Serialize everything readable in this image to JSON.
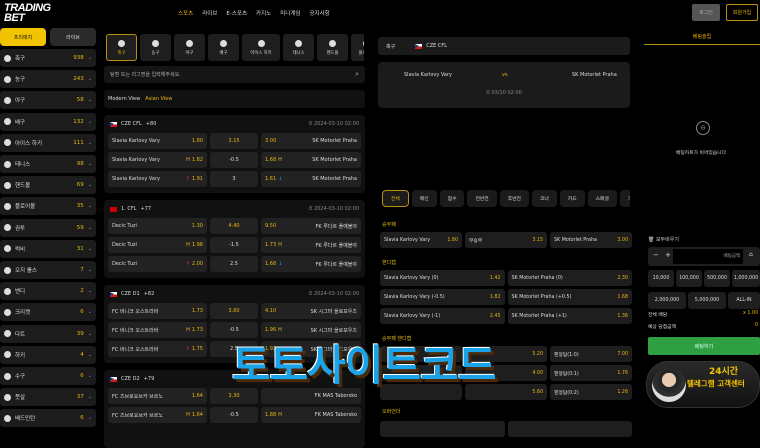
{
  "header": {
    "logo": "TRADING BET",
    "nav": [
      "스포츠",
      "라이브",
      "E-스포츠",
      "카지노",
      "미니게임",
      "공지사항"
    ],
    "login": "로그인",
    "signup": "회원가입"
  },
  "sidebar": {
    "prematch": "프리매치",
    "live": "라이브",
    "items": [
      {
        "label": "축구",
        "count": "938"
      },
      {
        "label": "농구",
        "count": "243"
      },
      {
        "label": "야구",
        "count": "58"
      },
      {
        "label": "배구",
        "count": "132"
      },
      {
        "label": "아이스 하키",
        "count": "111"
      },
      {
        "label": "테니스",
        "count": "98"
      },
      {
        "label": "핸드볼",
        "count": "69"
      },
      {
        "label": "플로어볼",
        "count": "35"
      },
      {
        "label": "권투",
        "count": "59"
      },
      {
        "label": "럭비",
        "count": "31"
      },
      {
        "label": "오지 룰스",
        "count": "7"
      },
      {
        "label": "밴디",
        "count": "2"
      },
      {
        "label": "크리켓",
        "count": "6"
      },
      {
        "label": "다트",
        "count": "39"
      },
      {
        "label": "하키",
        "count": "4"
      },
      {
        "label": "수구",
        "count": "6"
      },
      {
        "label": "풋살",
        "count": "37"
      },
      {
        "label": "배드민턴",
        "count": "6"
      }
    ]
  },
  "sport_tabs": [
    "축구",
    "농구",
    "야구",
    "배구",
    "아이스 하키",
    "테니스",
    "핸드볼",
    "플로어볼"
  ],
  "search": {
    "placeholder": "팀명 또는 리그명을 입력해주세요."
  },
  "views": {
    "modern": "Modern View",
    "asian": "Asian View"
  },
  "leagues": [
    {
      "name": "CZE CFL",
      "more": "+80",
      "time": "2024-03-10 02:00",
      "flag": "cz",
      "rows": [
        [
          "Slavia Karlovy Vary",
          "",
          "1.80",
          "3.15",
          "3.00",
          "",
          "SK Motorlet Praha"
        ],
        [
          "Slavia Karlovy Vary",
          "H",
          "1.82",
          "-0.5",
          "1.68",
          "H",
          "SK Motorlet Praha"
        ],
        [
          "Slavia Karlovy Vary",
          "↑",
          "1.91",
          "3",
          "1.61",
          "↓",
          "SK Motorlet Praha"
        ]
      ]
    },
    {
      "name": "1. CFL",
      "more": "+77",
      "time": "2024-03-10 02:00",
      "flag": "me",
      "rows": [
        [
          "Decic Tuzi",
          "",
          "1.30",
          "4.40",
          "9.50",
          "",
          "FK 루다르 플예블야"
        ],
        [
          "Decic Tuzi",
          "H",
          "1.98",
          "-1.5",
          "1.73",
          "H",
          "FK 루다르 플예블야"
        ],
        [
          "Decic Tuzi",
          "↑",
          "2.00",
          "2.5",
          "1.68",
          "↓",
          "FK 루다르 플예블야"
        ]
      ]
    },
    {
      "name": "CZE D1",
      "more": "+82",
      "time": "2024-03-10 02:00",
      "flag": "cz",
      "rows": [
        [
          "FC 바니크 오스트라바",
          "",
          "1.73",
          "3.60",
          "4.10",
          "",
          "SK 시그마 올로모우츠"
        ],
        [
          "FC 바니크 오스트라바",
          "H",
          "1.73",
          "-0.5",
          "1.96",
          "H",
          "SK 시그마 올로모우츠"
        ],
        [
          "FC 바니크 오스트라바",
          "↑",
          "1.75",
          "2.5",
          "1.92",
          "↓",
          "SK 시그마 올로모우츠"
        ]
      ]
    },
    {
      "name": "CZE D2",
      "more": "+79",
      "time": "",
      "flag": "cz",
      "rows": [
        [
          "FC 즈브로요브카 브르노",
          "",
          "1.64",
          "3.30",
          "",
          "",
          "FK MAS Taborsko"
        ],
        [
          "FC 즈브로요브카 브르노",
          "H",
          "1.64",
          "-0.5",
          "1.88",
          "H",
          "FK MAS Taborsko"
        ]
      ]
    }
  ],
  "detail": {
    "sport": "축구",
    "league": "CZE CFL",
    "home": "Slavia Karlovy Vary",
    "vs": "vs",
    "away": "SK Motorlet Praha",
    "time": "03/10 02:00",
    "tabs": [
      "전체",
      "메인",
      "점수",
      "전반전",
      "후반전",
      "코너",
      "카드",
      "스페셜",
      "기타"
    ],
    "sections": {
      "wdl": "승무패",
      "handicap": "핸디캡",
      "wdl_handicap": "승무패 핸디캡",
      "overunder": "오버언더"
    },
    "wdl": [
      [
        "Slavia Karlovy Vary",
        "1.80"
      ],
      [
        "무승부",
        "3.15"
      ],
      [
        "SK Motorlet Praha",
        "3.00"
      ]
    ],
    "handicap": [
      [
        [
          "Slavia Karlovy Vary (0)",
          "1.42"
        ],
        [
          "SK Motorlet Praha (0)",
          "2.30"
        ]
      ],
      [
        [
          "Slavia Karlovy Vary (-0.5)",
          "1.82"
        ],
        [
          "SK Motorlet Praha (+0.5)",
          "1.68"
        ]
      ],
      [
        [
          "Slavia Karlovy Vary (-1)",
          "2.45"
        ],
        [
          "SK Motorlet Praha (+1)",
          "1.36"
        ]
      ]
    ],
    "wdl_handicap": [
      [
        [
          "",
          ""
        ],
        [
          "",
          "5.20"
        ],
        [
          "핸정답(1:0)",
          "7.00"
        ]
      ],
      [
        [
          "",
          ""
        ],
        [
          "",
          "4.00"
        ],
        [
          "핸정답(0:1)",
          "1.76"
        ]
      ],
      [
        [
          "",
          ""
        ],
        [
          "",
          "5.60"
        ],
        [
          "핸정답(0:2)",
          "1.26"
        ]
      ]
    ]
  },
  "slip": {
    "tab": "베팅슬립",
    "empty": "베팅카트가 비어있습니다",
    "clear": "모두비우기",
    "minus": "−",
    "plus": "+",
    "amount_placeholder": "베팅금액",
    "chips": [
      "10,000",
      "100,000",
      "500,000",
      "1,000,000",
      "2,000,000",
      "5,000,000",
      "ALL-IN"
    ],
    "total_odds_label": "전체 배당",
    "total_odds": "x 1.00",
    "expected_label": "예상 당첨금액",
    "expected": "0",
    "bet": "베팅하기",
    "banner_line1": "24시간",
    "banner_line2": "텔레그램 고객센터"
  },
  "watermark": "토토사이트코드",
  "colors": {
    "accent": "#e8b80f",
    "green": "#2ea043",
    "watermark": "#1aa3e8"
  }
}
